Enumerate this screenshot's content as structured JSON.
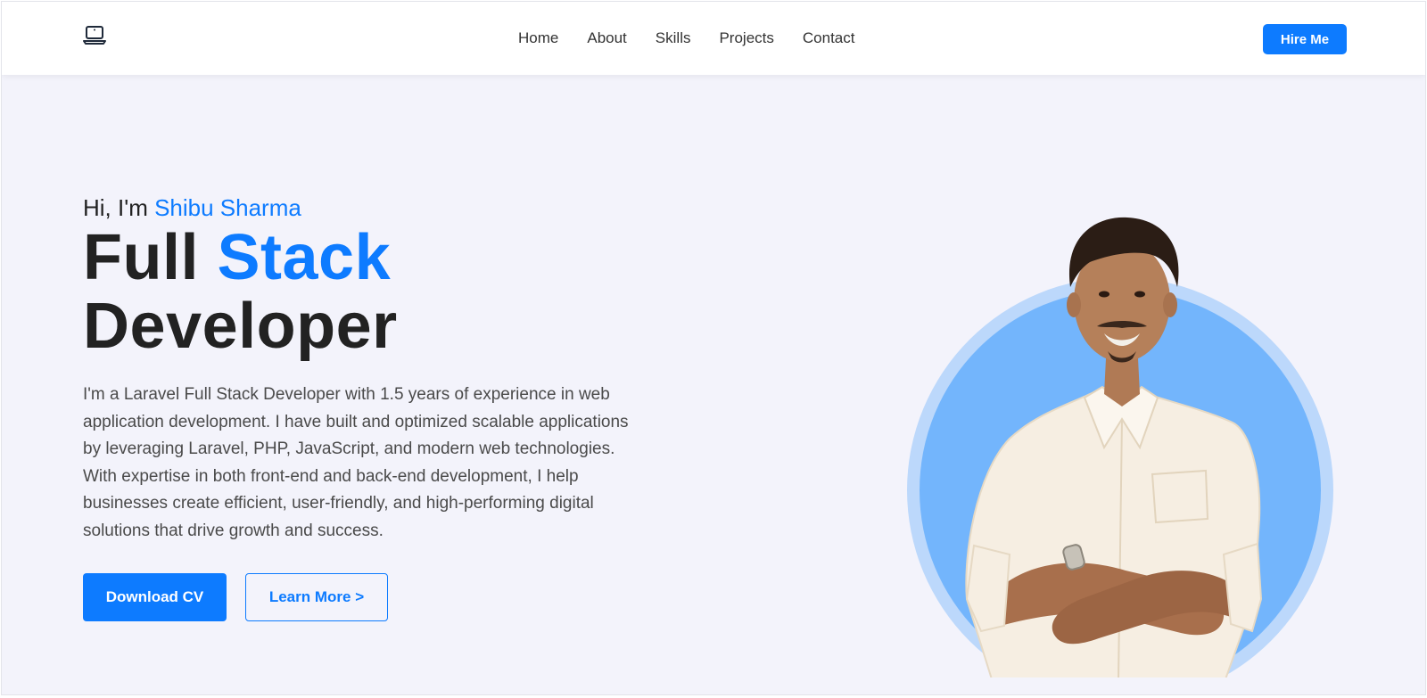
{
  "navbar": {
    "logo_icon": "laptop-icon",
    "links": [
      "Home",
      "About",
      "Skills",
      "Projects",
      "Contact"
    ],
    "hire_label": "Hire Me"
  },
  "hero": {
    "greeting_prefix": "Hi, I'm ",
    "name": "Shibu Sharma",
    "headline_part1": "Full ",
    "headline_accent": "Stack",
    "headline_part2": "Developer",
    "bio": "I'm a Laravel Full Stack Developer with 1.5 years of experience in web application development. I have built and optimized scalable applications by leveraging Laravel, PHP, JavaScript, and modern web technologies. With expertise in both front-end and back-end development, I help businesses create efficient, user-friendly, and high-performing digital solutions that drive growth and success.",
    "download_label": "Download CV",
    "learn_more_label": "Learn More >"
  },
  "colors": {
    "accent": "#0d7bff",
    "background": "#f3f3fb",
    "circle_outer": "#bcd8fb",
    "circle_inner": "#73b5fc"
  }
}
